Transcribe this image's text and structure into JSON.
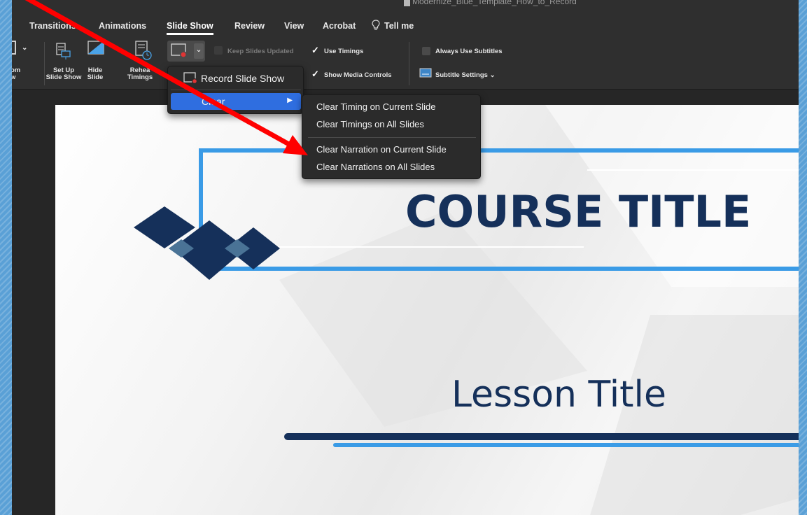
{
  "window": {
    "document_title": "Modernize_Blue_Template_How_to_Record"
  },
  "ribbon_tabs": {
    "transitions": "Transitions",
    "animations": "Animations",
    "slide_show": "Slide Show",
    "review": "Review",
    "view": "View",
    "acrobat": "Acrobat",
    "tell_me": "Tell me"
  },
  "ribbon": {
    "from_line1": "om",
    "from_line2": "w",
    "setup_line1": "Set Up",
    "setup_line2": "Slide Show",
    "hide_line1": "Hide",
    "hide_line2": "Slide",
    "rehearse_line1": "Rehea",
    "rehearse_line2": "Timings",
    "keep_slides_updated": "Keep Slides Updated",
    "use_timings": "Use Timings",
    "show_media_controls": "Show Media Controls",
    "always_use_subtitles": "Always Use Subtitles",
    "subtitle_settings": "Subtitle Settings"
  },
  "record_menu": {
    "record_slide_show": "Record Slide Show",
    "clear": "Clear",
    "submenu_arrow": "▶"
  },
  "clear_submenu": {
    "items": [
      "Clear Timing on Current Slide",
      "Clear Timings on All Slides",
      "Clear Narration on Current Slide",
      "Clear Narrations on All Slides"
    ]
  },
  "slide": {
    "course_title": "COURSE TITLE",
    "lesson_title": "Lesson Title"
  },
  "colors": {
    "accent_blue": "#2f6ee0",
    "slide_navy": "#15305a",
    "slide_line_blue": "#3a9be6",
    "annotation_red": "#ff0000"
  }
}
